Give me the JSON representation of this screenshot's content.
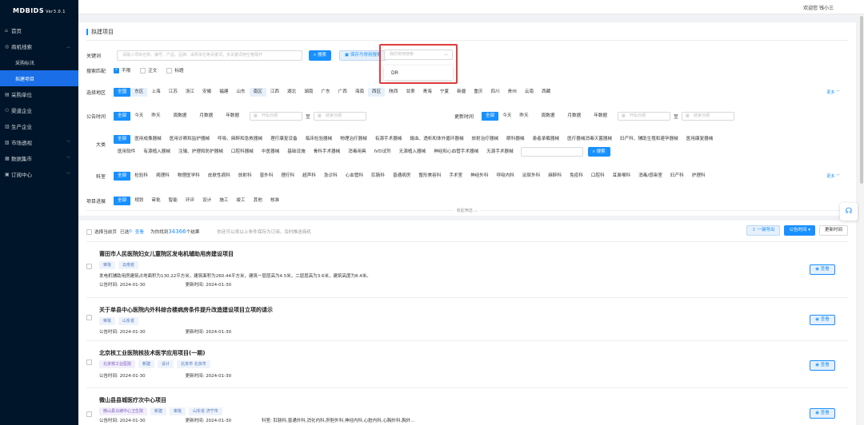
{
  "app": {
    "logo": "MDBIDS",
    "version": "Ver3.0.1"
  },
  "topbar": {
    "welcome": "欢迎您 钱小三"
  },
  "sidebar": {
    "items": [
      {
        "label": "首页",
        "icon": "home-icon"
      },
      {
        "label": "商机线索",
        "icon": "target-icon"
      },
      {
        "label": "采购单位",
        "icon": "building-icon"
      },
      {
        "label": "渠道企业",
        "icon": "users-icon"
      },
      {
        "label": "生产企业",
        "icon": "factory-icon"
      },
      {
        "label": "市场透视",
        "icon": "chart-icon"
      },
      {
        "label": "数据集市",
        "icon": "database-icon"
      },
      {
        "label": "订阅中心",
        "icon": "subscribe-icon"
      }
    ],
    "sub_items": [
      {
        "label": "采购标讯"
      },
      {
        "label": "拟建项目"
      }
    ]
  },
  "filter": {
    "title": "拟建项目",
    "keyword": {
      "label": "关键词",
      "placeholder": "请输入项目名称、编号、产品、品牌、采购单位等关键词，多关键词用空格隔开",
      "search_btn": "搜索",
      "save_btn": "保存为常用搜索",
      "common_placeholder": "我的常用搜索",
      "dropdown_option": "DR"
    },
    "match": {
      "label": "搜索匹配",
      "options": [
        "不限",
        "正文",
        "标题"
      ]
    },
    "region": {
      "label": "选择地区",
      "items": [
        "全国",
        "东区",
        "上海",
        "江苏",
        "浙江",
        "安徽",
        "福建",
        "山东",
        "南区",
        "江西",
        "湖北",
        "湖南",
        "广东",
        "广西",
        "海南",
        "西区",
        "陕西",
        "甘肃",
        "青海",
        "宁夏",
        "新疆",
        "重庆",
        "四川",
        "贵州",
        "云南",
        "西藏"
      ],
      "more": "更多"
    },
    "publish_time": {
      "label": "公告时间",
      "items": [
        "全部",
        "今天",
        "昨天",
        "周数据",
        "月数据",
        "年数据"
      ],
      "start": "开始日期",
      "to": "至",
      "end": "结束日期"
    },
    "update_time": {
      "label": "更新时间",
      "items": [
        "全部",
        "今天",
        "昨天",
        "周数据",
        "月数据",
        "年数据"
      ],
      "start": "开始日期",
      "to": "至",
      "end": "结束日期"
    },
    "category": {
      "label": "大类",
      "all": "全部",
      "row1": [
        "医用成像器械",
        "医用诊察和监护器械",
        "呼吸、麻醉和急救器械",
        "理疗康复设备",
        "临床检验器械",
        "物理治疗器械",
        "有源手术器械",
        "输血、透析和体外循环器械",
        "放射治疗器械",
        "眼科器械",
        "患者承载器械",
        "医疗器械消毒灭菌器械",
        "妇产科、辅助生殖和避孕器械",
        "医用康复器械"
      ],
      "row2": [
        "医用软件",
        "有源植入器械",
        "注输、护理和防护器械",
        "口腔科器械",
        "中医器械",
        "基础设施",
        "骨科手术器械",
        "消毒用具",
        "IVD试剂",
        "无源植入器械",
        "神经和心血管手术器械",
        "无源手术器械"
      ],
      "search_btn": "搜索"
    },
    "department": {
      "label": "科室",
      "items": [
        "全部",
        "检验科",
        "病理科",
        "物理医学科",
        "皮肤性病科",
        "放射科",
        "普外科",
        "理疗科",
        "超声科",
        "急诊科",
        "心血管科",
        "肛肠科",
        "普通病房",
        "整形美容科",
        "手术室",
        "神经外科",
        "呼吸内科",
        "泌尿外科",
        "麻醉科",
        "免疫科",
        "口腔科",
        "耳鼻喉科",
        "消毒/感染室",
        "妇产科",
        "护理科"
      ],
      "more": "更多"
    },
    "progress": {
      "label": "项目进展",
      "items": [
        "全部",
        "规划",
        "审批",
        "智能",
        "环评",
        "设计",
        "施工",
        "竣工",
        "其他",
        "核准"
      ]
    },
    "collapse": "收起筛选"
  },
  "list": {
    "select_page": "选择当前页",
    "selected_prefix": "已选",
    "selected_count": "0",
    "clear": "查看",
    "found_prefix": "为你找到",
    "found_count": "34366",
    "found_suffix": "个结果",
    "hint": "你还可以将以上条件保存为订阅，及时推送商机",
    "export_btn": "一键导出",
    "sort_btn": "公告时间",
    "update_btn": "更新时间",
    "view_label": "查看",
    "date_pub_label": "公告时间:",
    "date_upd_label": "更新时间:",
    "projects": [
      {
        "title": "莆田市人民医院妇女儿童院区发电机辅助用房建设项目",
        "tags": [
          "审批",
          "云南省"
        ],
        "desc": "发电机辅助用房建筑占地面积为130.22平方米，建筑面积为260.44平方米，建筑一层层高为4.5米，二层层高为3.6米，建筑高度为8.4米。",
        "pub": "2024-01-30",
        "upd": "2024-01-30"
      },
      {
        "title": "关于单县中心医院内外科综合楼病房条件提升改造建设项目立项的请示",
        "tags": [
          "审批",
          "山东省"
        ],
        "pub": "2024-01-30",
        "upd": "2024-01-30"
      },
      {
        "title": "北京核工业医院核技术医学应用项目(一期)",
        "tags": [
          "北京核工业医院",
          "新建",
          "设计",
          "北京市 北京市"
        ],
        "pub": "2024-01-30",
        "upd": "2024-01-30"
      },
      {
        "title": "微山县县城医疗次中心项目",
        "tags": [
          "微山县马坡中心卫生院",
          "新建",
          "审批",
          "山东省 济宁市"
        ],
        "pub": "2024-01-30",
        "upd": "2024-01-30",
        "dept": "科室: 肛肠科,普通外科,消化内科,肝胆外科,神经内科,心脏内科,心胸外科,胸外..."
      }
    ]
  },
  "colors": {
    "primary": "#1890ff",
    "sidebar": "#001529",
    "highlight": "#e23b3b"
  }
}
